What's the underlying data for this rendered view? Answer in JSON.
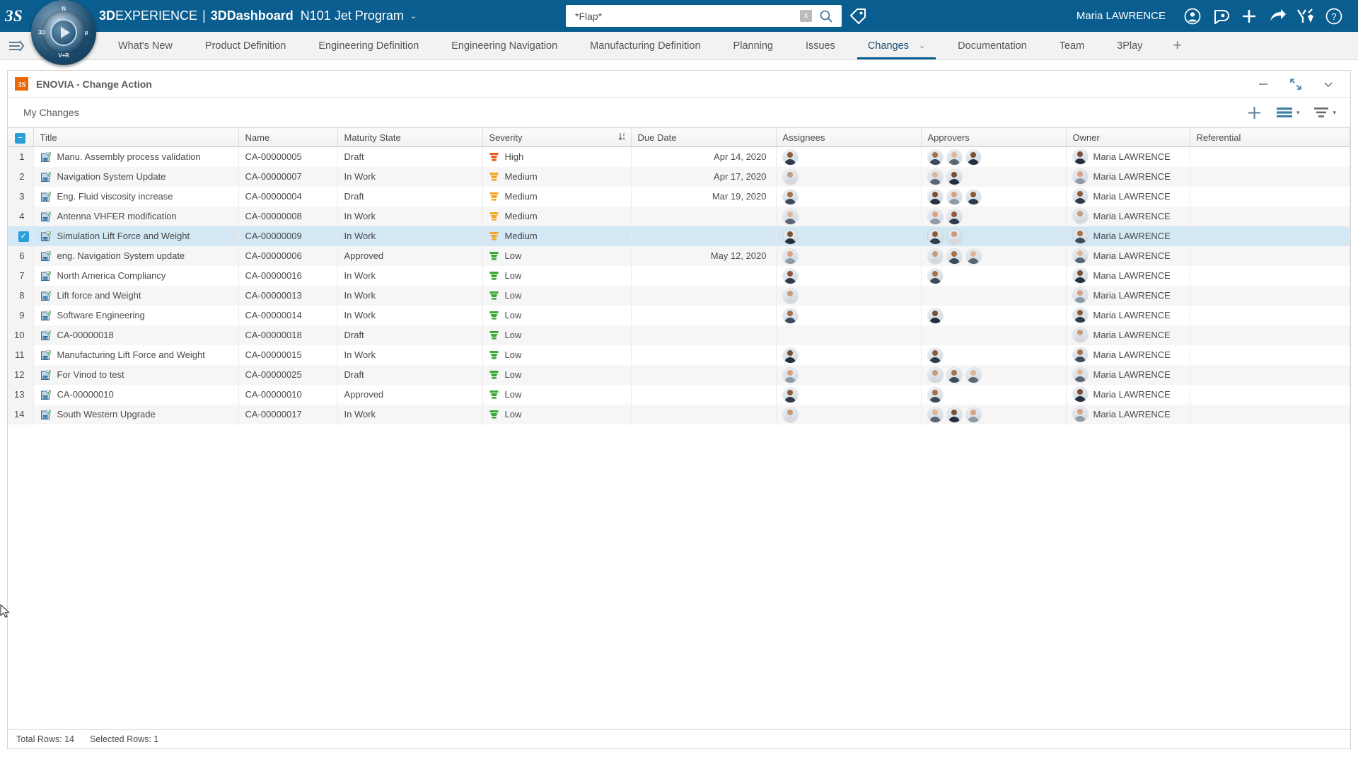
{
  "topbar": {
    "brand_bold": "3D",
    "brand_light": "EXPERIENCE",
    "brand_sep": "|",
    "brand_app": "3DDashboard",
    "project": "N101 Jet Program",
    "project_caret": "⌄",
    "search_value": "*Flap*",
    "search_placeholder": "Search",
    "search_clear_label": "x",
    "user_name": "Maria LAWRENCE",
    "icons": [
      "tag-icon",
      "user-account-icon",
      "notifications-icon",
      "add-icon",
      "share-icon",
      "tools-icon",
      "help-icon"
    ]
  },
  "nav": {
    "menu_icon": "hamburger-menu-icon",
    "tabs": [
      {
        "label": "What's New",
        "active": false,
        "caret": ""
      },
      {
        "label": "Product Definition",
        "active": false,
        "caret": ""
      },
      {
        "label": "Engineering Definition",
        "active": false,
        "caret": ""
      },
      {
        "label": "Engineering Navigation",
        "active": false,
        "caret": ""
      },
      {
        "label": "Manufacturing Definition",
        "active": false,
        "caret": ""
      },
      {
        "label": "Planning",
        "active": false,
        "caret": ""
      },
      {
        "label": "Issues",
        "active": false,
        "caret": ""
      },
      {
        "label": "Changes",
        "active": true,
        "caret": "⌄"
      },
      {
        "label": "Documentation",
        "active": false,
        "caret": ""
      },
      {
        "label": "Team",
        "active": false,
        "caret": ""
      },
      {
        "label": "3Play",
        "active": false,
        "caret": ""
      }
    ],
    "add_tab_label": "+"
  },
  "panel": {
    "app_icon": "enovia-icon",
    "title": "ENOVIA - Change Action",
    "controls": [
      {
        "name": "minimize-button",
        "glyph": "—"
      },
      {
        "name": "restore-button",
        "glyph": "⤢"
      },
      {
        "name": "expand-button",
        "glyph": "⌄"
      }
    ],
    "toolbar": {
      "tab_label": "My Changes",
      "add_label": "+",
      "view_label": "list-view-icon",
      "filter_label": "filter-icon",
      "caret": "▾"
    }
  },
  "table": {
    "columns": [
      {
        "key": "num",
        "label": ""
      },
      {
        "key": "title",
        "label": "Title"
      },
      {
        "key": "name",
        "label": "Name"
      },
      {
        "key": "maturity",
        "label": "Maturity State"
      },
      {
        "key": "severity",
        "label": "Severity",
        "sorted": true,
        "sort_glyph": "↓"
      },
      {
        "key": "due",
        "label": "Due Date"
      },
      {
        "key": "assignees",
        "label": "Assignees"
      },
      {
        "key": "approvers",
        "label": "Approvers"
      },
      {
        "key": "owner",
        "label": "Owner"
      },
      {
        "key": "referential",
        "label": "Referential"
      }
    ],
    "header_checkbox_glyph": "−",
    "rows": [
      {
        "num": "1",
        "title": "Manu. Assembly process validation",
        "name": "CA-00000005",
        "maturity": "Draft",
        "severity": "High",
        "sev_color": "#ec5b21",
        "due": "Apr 14, 2020",
        "assignees": 1,
        "approvers": 3,
        "owner": "Maria LAWRENCE",
        "referential": "",
        "selected": false
      },
      {
        "num": "2",
        "title": "Navigation System Update",
        "name": "CA-00000007",
        "maturity": "In Work",
        "severity": "Medium",
        "sev_color": "#f5a623",
        "due": "Apr 17, 2020",
        "assignees": 1,
        "approvers": 2,
        "owner": "Maria LAWRENCE",
        "referential": "",
        "selected": false
      },
      {
        "num": "3",
        "title": "Eng. Fluid viscosity increase",
        "name": "CA-00000004",
        "maturity": "Draft",
        "severity": "Medium",
        "sev_color": "#f5a623",
        "due": "Mar 19, 2020",
        "assignees": 1,
        "approvers": 3,
        "owner": "Maria LAWRENCE",
        "referential": "",
        "selected": false
      },
      {
        "num": "4",
        "title": "Antenna VHFER modification",
        "name": "CA-00000008",
        "maturity": "In Work",
        "severity": "Medium",
        "sev_color": "#f5a623",
        "due": "",
        "assignees": 1,
        "approvers": 2,
        "owner": "Maria LAWRENCE",
        "referential": "",
        "selected": false
      },
      {
        "num": "5",
        "title": "Simulation Lift Force and Weight",
        "name": "CA-00000009",
        "maturity": "In Work",
        "severity": "Medium",
        "sev_color": "#f5a623",
        "due": "",
        "assignees": 1,
        "approvers": 2,
        "owner": "Maria LAWRENCE",
        "referential": "",
        "selected": true
      },
      {
        "num": "6",
        "title": "eng. Navigation System update",
        "name": "CA-00000006",
        "maturity": "Approved",
        "severity": "Low",
        "sev_color": "#3ba935",
        "due": "May 12, 2020",
        "assignees": 1,
        "approvers": 3,
        "owner": "Maria LAWRENCE",
        "referential": "",
        "selected": false
      },
      {
        "num": "7",
        "title": "North America Compliancy",
        "name": "CA-00000016",
        "maturity": "In Work",
        "severity": "Low",
        "sev_color": "#3ba935",
        "due": "",
        "assignees": 1,
        "approvers": 1,
        "owner": "Maria LAWRENCE",
        "referential": "",
        "selected": false
      },
      {
        "num": "8",
        "title": "Lift force and Weight",
        "name": "CA-00000013",
        "maturity": "In Work",
        "severity": "Low",
        "sev_color": "#3ba935",
        "due": "",
        "assignees": 1,
        "approvers": 0,
        "owner": "Maria LAWRENCE",
        "referential": "",
        "selected": false
      },
      {
        "num": "9",
        "title": "Software Engineering",
        "name": "CA-00000014",
        "maturity": "In Work",
        "severity": "Low",
        "sev_color": "#3ba935",
        "due": "",
        "assignees": 1,
        "approvers": 1,
        "owner": "Maria LAWRENCE",
        "referential": "",
        "selected": false
      },
      {
        "num": "10",
        "title": "CA-00000018",
        "name": "CA-00000018",
        "maturity": "Draft",
        "severity": "Low",
        "sev_color": "#3ba935",
        "due": "",
        "assignees": 0,
        "approvers": 0,
        "owner": "Maria LAWRENCE",
        "referential": "",
        "selected": false
      },
      {
        "num": "11",
        "title": "Manufacturing Lift Force and Weight",
        "name": "CA-00000015",
        "maturity": "In Work",
        "severity": "Low",
        "sev_color": "#3ba935",
        "due": "",
        "assignees": 1,
        "approvers": 1,
        "owner": "Maria LAWRENCE",
        "referential": "",
        "selected": false
      },
      {
        "num": "12",
        "title": "For Vinod to test",
        "name": "CA-00000025",
        "maturity": "Draft",
        "severity": "Low",
        "sev_color": "#3ba935",
        "due": "",
        "assignees": 1,
        "approvers": 3,
        "owner": "Maria LAWRENCE",
        "referential": "",
        "selected": false
      },
      {
        "num": "13",
        "title": "CA-00000010",
        "name": "CA-00000010",
        "maturity": "Approved",
        "severity": "Low",
        "sev_color": "#3ba935",
        "due": "",
        "assignees": 1,
        "approvers": 1,
        "owner": "Maria LAWRENCE",
        "referential": "",
        "selected": false
      },
      {
        "num": "14",
        "title": "South Western Upgrade",
        "name": "CA-00000017",
        "maturity": "In Work",
        "severity": "Low",
        "sev_color": "#3ba935",
        "due": "",
        "assignees": 1,
        "approvers": 3,
        "owner": "Maria LAWRENCE",
        "referential": "",
        "selected": false
      }
    ]
  },
  "statusbar": {
    "total_rows": "Total Rows: 14",
    "selected_rows": "Selected Rows: 1"
  },
  "colors": {
    "brand_blue": "#0a5d8f",
    "selection_blue": "#d3e7f4",
    "accent_orange": "#ec6707",
    "severity_high": "#ec5b21",
    "severity_medium": "#f5a623",
    "severity_low": "#3ba935"
  }
}
